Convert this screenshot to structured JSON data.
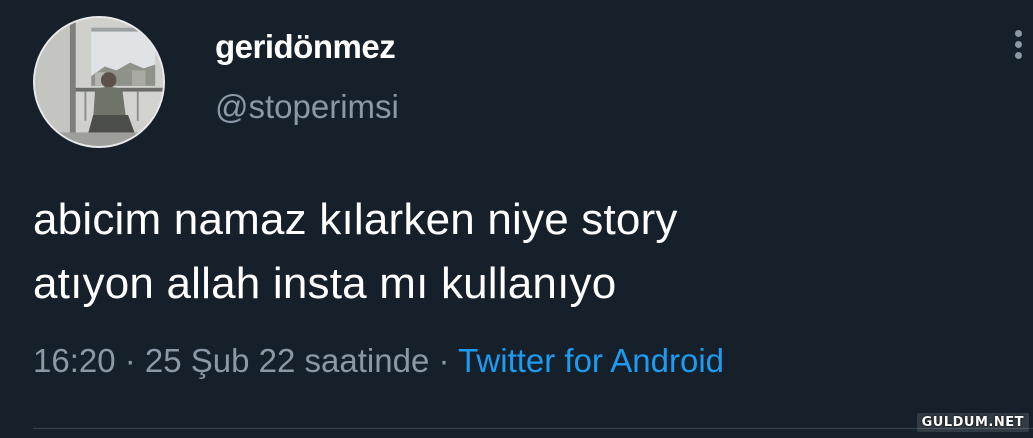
{
  "user": {
    "display_name": "geridönmez",
    "handle": "@stoperimsi"
  },
  "tweet": {
    "text_line1": "abicim namaz kılarken niye story",
    "text_line2": "atıyon allah insta mı kullanıyo"
  },
  "meta": {
    "time": "16:20",
    "sep1": " · ",
    "date": "25 Şub 22",
    "suffix": " saatinde",
    "sep2": " · ",
    "source": "Twitter for Android"
  },
  "watermark": "GULDUM.NET",
  "colors": {
    "background": "#15202b",
    "muted": "#8b98a5",
    "link": "#1d9bf0",
    "text": "#ffffff"
  },
  "icons": {
    "more": "more-options-icon"
  }
}
